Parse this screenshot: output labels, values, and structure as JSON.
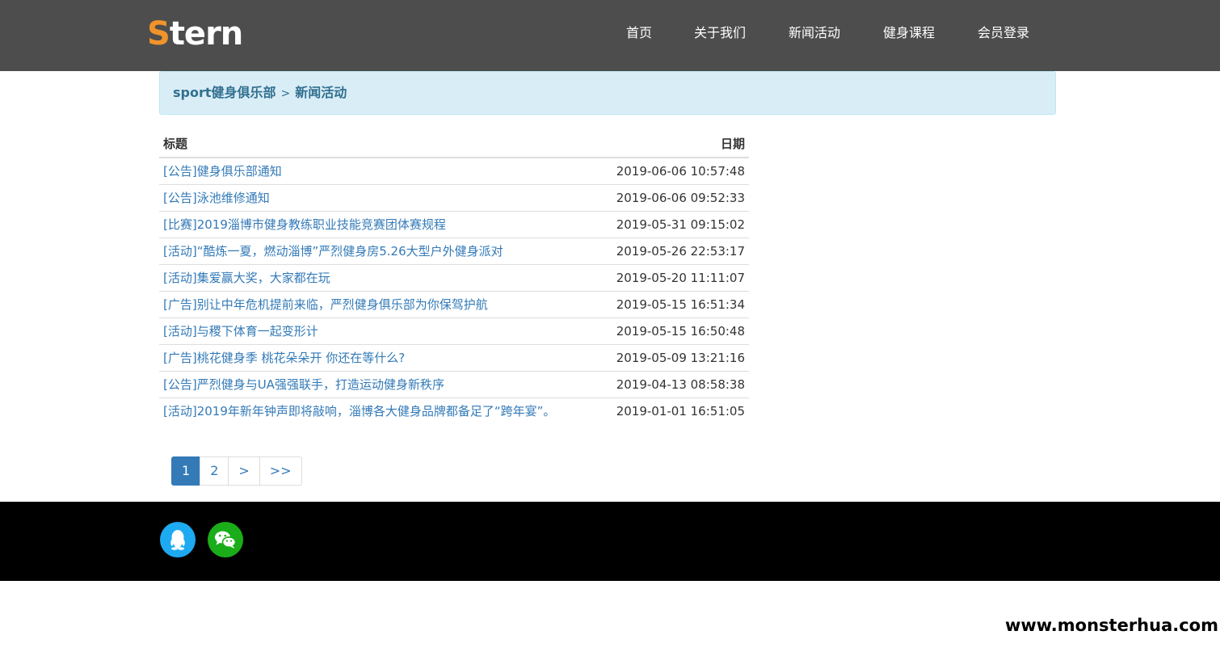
{
  "header": {
    "logo_first": "S",
    "logo_rest": "tern",
    "nav": [
      "首页",
      "关于我们",
      "新闻活动",
      "健身课程",
      "会员登录"
    ]
  },
  "breadcrumb": {
    "root": "sport健身俱乐部",
    "separator": ">",
    "current": "新闻活动"
  },
  "table": {
    "headers": {
      "title": "标题",
      "date": "日期"
    },
    "rows": [
      {
        "title": "[公告]健身俱乐部通知",
        "date": "2019-06-06 10:57:48"
      },
      {
        "title": "[公告]泳池维修通知",
        "date": "2019-06-06 09:52:33"
      },
      {
        "title": "[比赛]2019淄博市健身教练职业技能竞赛团体赛规程",
        "date": "2019-05-31 09:15:02"
      },
      {
        "title": "[活动]“酷炼一夏，燃动淄博”严烈健身房5.26大型户外健身派对",
        "date": "2019-05-26 22:53:17"
      },
      {
        "title": "[活动]集爱赢大奖，大家都在玩",
        "date": "2019-05-20 11:11:07"
      },
      {
        "title": "[广告]别让中年危机提前来临，严烈健身俱乐部为你保驾护航",
        "date": "2019-05-15 16:51:34"
      },
      {
        "title": "[活动]与稷下体育一起变形计",
        "date": "2019-05-15 16:50:48"
      },
      {
        "title": "[广告]桃花健身季 桃花朵朵开 你还在等什么?",
        "date": "2019-05-09 13:21:16"
      },
      {
        "title": "[公告]严烈健身与UA强强联手，打造运动健身新秩序",
        "date": "2019-04-13 08:58:38"
      },
      {
        "title": "[活动]2019年新年钟声即将敲响，淄博各大健身品牌都备足了“跨年宴”。",
        "date": "2019-01-01 16:51:05"
      }
    ]
  },
  "pagination": {
    "pages": [
      "1",
      "2",
      ">",
      ">>"
    ],
    "current": "1"
  },
  "footer": {
    "icons": [
      "qq-icon",
      "wechat-icon"
    ],
    "colors": {
      "qq": "#1eaaf1",
      "wechat": "#1aad19"
    }
  },
  "watermark": "www.monsterhua.com",
  "colors": {
    "header_bg": "#4d4d4d",
    "logo_accent": "#f0932b",
    "link": "#337ab7",
    "breadcrumb_bg": "#d9edf7",
    "footer_bg": "#000000"
  }
}
